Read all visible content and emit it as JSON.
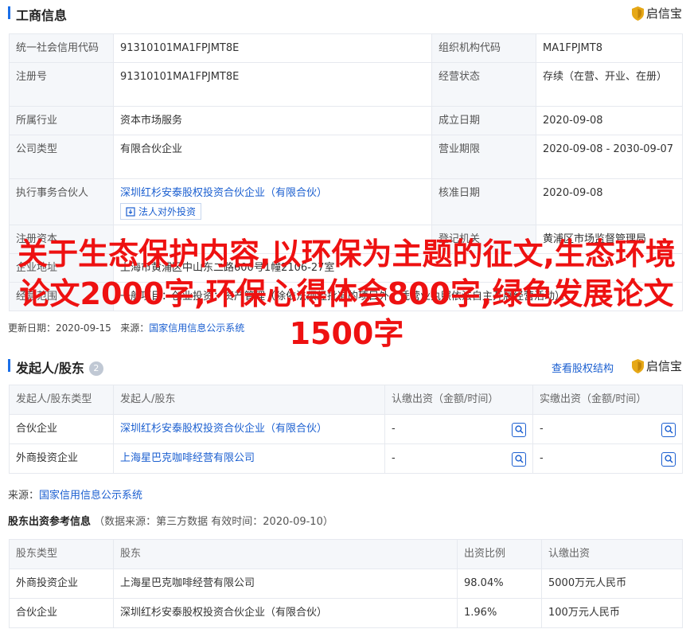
{
  "brand": {
    "name": "启信宝"
  },
  "business": {
    "title": "工商信息",
    "rows": [
      {
        "l1": "统一社会信用代码",
        "v1": "91310101MA1FPJMT8E",
        "l2": "组织机构代码",
        "v2": "MA1FPJMT8"
      },
      {
        "l1": "注册号",
        "v1": "91310101MA1FPJMT8E",
        "l2": "经营状态",
        "v2": "存续（在营、开业、在册）"
      },
      {
        "l1": "所属行业",
        "v1": "资本市场服务",
        "l2": "成立日期",
        "v2": "2020-09-08"
      },
      {
        "l1": "公司类型",
        "v1": "有限合伙企业",
        "l2": "营业期限",
        "v2": "2020-09-08 - 2030-09-07"
      },
      {
        "l1": "执行事务合伙人",
        "v1": "深圳红杉安泰股权投资合伙企业（有限合伙）",
        "l2": "核准日期",
        "v2": "2020-09-08"
      },
      {
        "l1": "注册资本",
        "v1": "-",
        "l2": "登记机关",
        "v2": "黄浦区市场监督管理局"
      }
    ],
    "invest_button": "法人对外投资",
    "address_label": "企业地址",
    "address_value": "上海市黄浦区中山东二路600号1幢2106-27室",
    "scope_label": "经营范围",
    "scope_value": "一般项目：创业投资；资产管理（除依法须经批准的项目外，凭营业执照依法自主开展经营活动）。",
    "source_update_label": "更新日期",
    "source_update_value": "2020-09-15",
    "source_label": "来源：",
    "source_link": "国家信用信息公示系统"
  },
  "shareholders": {
    "title": "发起人/股东",
    "count": "2",
    "structure_link": "查看股权结构",
    "columns": [
      "发起人/股东类型",
      "发起人/股东",
      "认缴出资（金额/时间）",
      "实缴出资（金额/时间）"
    ],
    "rows": [
      {
        "type": "合伙企业",
        "name": "深圳红杉安泰股权投资合伙企业（有限合伙）",
        "subscribed": "-",
        "paid": "-"
      },
      {
        "type": "外商投资企业",
        "name": "上海星巴克咖啡经营有限公司",
        "subscribed": "-",
        "paid": "-"
      }
    ],
    "source_label": "来源：",
    "source_link": "国家信用信息公示系统"
  },
  "reference": {
    "title": "股东出资参考信息",
    "meta": "（数据来源：第三方数据 有效时间：2020-09-10）",
    "columns": [
      "股东类型",
      "股东",
      "出资比例",
      "认缴出资"
    ],
    "rows": [
      {
        "type": "外商投资企业",
        "name": "上海星巴克咖啡经营有限公司",
        "ratio": "98.04%",
        "amount": "5000万元人民币"
      },
      {
        "type": "合伙企业",
        "name": "深圳红杉安泰股权投资合伙企业（有限合伙）",
        "ratio": "1.96%",
        "amount": "100万元人民币"
      }
    ]
  },
  "overlay_text": "关于生态保护内容,以环保为主题的征文,生态环境论文2000字,环保心得体会800字,绿色发展论文1500字",
  "colors": {
    "accent": "#1b6fe8",
    "link": "#1b5fd0",
    "overlay": "#ee1111",
    "brand_gold": "#e6a817"
  }
}
